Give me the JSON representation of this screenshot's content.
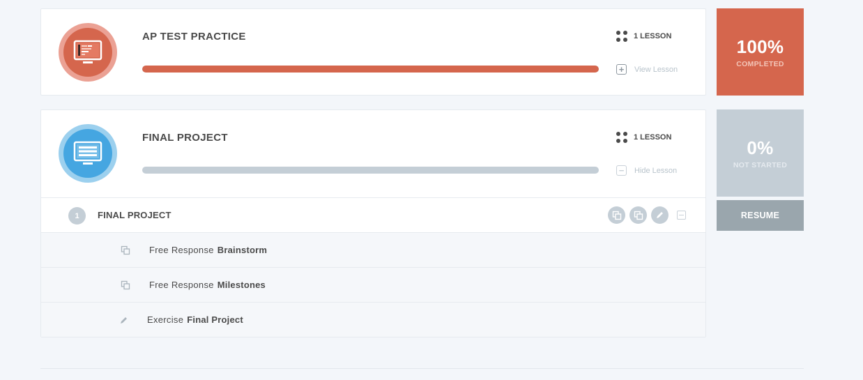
{
  "units": [
    {
      "title": "AP TEST PRACTICE",
      "lesson_count": "1 LESSON",
      "toggle_label": "View Lesson",
      "progress": 1.0,
      "status_percent": "100%",
      "status_label": "COMPLETED",
      "accent_color": "#d5664d"
    },
    {
      "title": "FINAL PROJECT",
      "lesson_count": "1 LESSON",
      "toggle_label": "Hide Lesson",
      "progress": 0.0,
      "status_percent": "0%",
      "status_label": "NOT STARTED",
      "accent_color": "#45a6e1",
      "lesson": {
        "number": "1",
        "title": "FINAL PROJECT",
        "actions": [
          "copy-icon",
          "copy-icon",
          "pencil-icon",
          "collapse-icon"
        ],
        "activities": [
          {
            "type": "Free Response",
            "name": "Brainstorm",
            "icon": "copy-icon"
          },
          {
            "type": "Free Response",
            "name": "Milestones",
            "icon": "copy-icon"
          },
          {
            "type": "Exercise",
            "name": "Final Project",
            "icon": "pencil-icon"
          }
        ]
      }
    }
  ],
  "resume_label": "RESUME",
  "colors": {
    "orange": "#d5664d",
    "blue": "#45a6e1",
    "gray": "#c4ced6",
    "resume_gray": "#9aa6ad",
    "background": "#f3f6fa"
  }
}
